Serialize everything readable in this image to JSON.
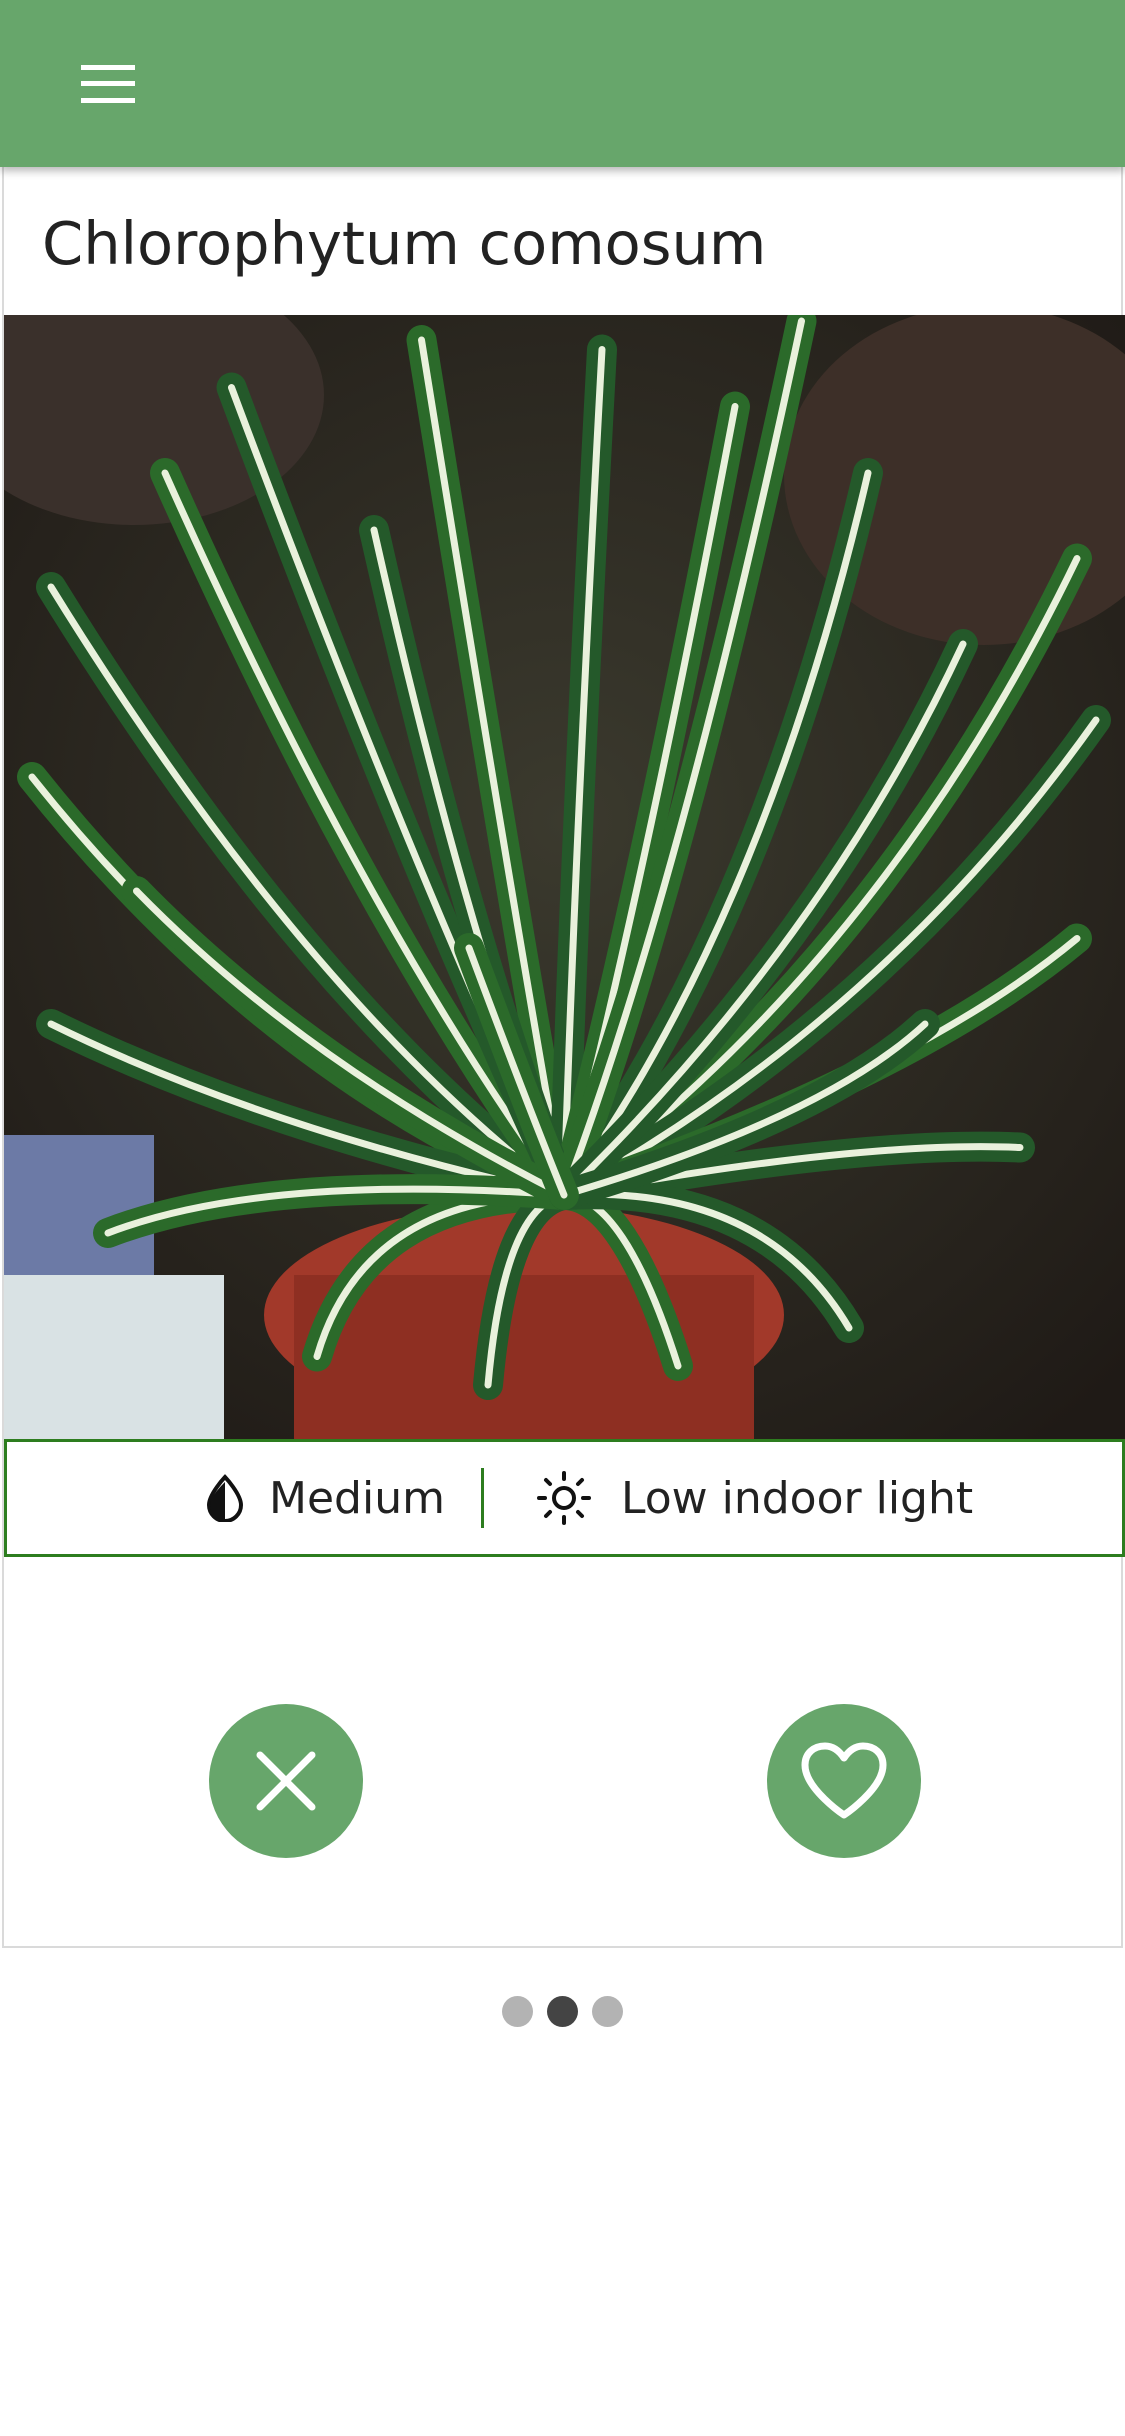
{
  "appbar": {
    "menu_icon": "hamburger-menu-icon",
    "color": "#67a66b"
  },
  "plant": {
    "name": "Chlorophytum comosum",
    "photo_description": "spider plant",
    "watering": {
      "icon": "water-drop-icon",
      "label": "Medium"
    },
    "light": {
      "icon": "sun-icon",
      "label": "Low indoor light"
    }
  },
  "actions": {
    "dismiss_icon": "close-icon",
    "favorite_icon": "heart-icon"
  },
  "pager": {
    "count": 3,
    "active_index": 1
  },
  "colors": {
    "accent": "#67a66b",
    "care_border": "#2d7d1f"
  }
}
